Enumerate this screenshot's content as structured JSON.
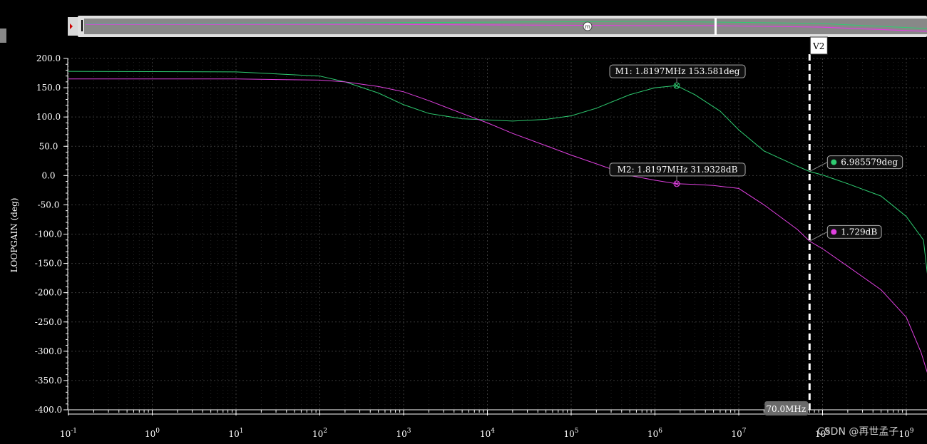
{
  "chart_data": {
    "type": "line",
    "ylabel": "LOOPGAIN (deg)",
    "xscale": "log",
    "x_decade_min": -1,
    "x_decade_max": 8,
    "ylim": [
      -400,
      200
    ],
    "yticks": [
      "200.0",
      "150.0",
      "100.0",
      "50.0",
      "0.0",
      "-50.0",
      "-100.0",
      "-150.0",
      "-200.0",
      "-250.0",
      "-300.0",
      "-350.0",
      "-400.0"
    ],
    "xticks": [
      {
        "base": "10",
        "exp": "-1"
      },
      {
        "base": "10",
        "exp": "0"
      },
      {
        "base": "10",
        "exp": "1"
      },
      {
        "base": "10",
        "exp": "2"
      },
      {
        "base": "10",
        "exp": "3"
      },
      {
        "base": "10",
        "exp": "4"
      },
      {
        "base": "10",
        "exp": "5"
      },
      {
        "base": "10",
        "exp": "6"
      },
      {
        "base": "10",
        "exp": "7"
      },
      {
        "base": "10",
        "exp": "8"
      },
      {
        "base": "10",
        "exp": "9"
      }
    ],
    "grid": true,
    "series": [
      {
        "color": "#2ecc71",
        "x": [
          0.1,
          10,
          100,
          200,
          500,
          1000,
          2000,
          5000,
          10000,
          20000,
          50000,
          100000,
          200000,
          500000,
          1000000,
          1800000,
          3000000,
          6000000,
          10000000,
          20000000,
          50000000,
          70000000,
          100000000,
          200000000,
          500000000,
          1000000000,
          1600000000,
          2000000000
        ],
        "y": [
          178,
          177,
          170,
          160,
          141,
          121,
          106,
          97,
          95,
          93,
          96,
          102,
          115,
          138,
          150,
          153.6,
          138,
          110,
          78,
          42,
          16,
          7,
          1,
          -14,
          -35,
          -70,
          -110,
          -230
        ]
      },
      {
        "color": "#e040e0",
        "x": [
          0.1,
          10,
          100,
          200,
          500,
          1000,
          2000,
          5000,
          10000,
          20000,
          50000,
          100000,
          200000,
          500000,
          1000000,
          1800000,
          3000000,
          5000000,
          10000000,
          20000000,
          50000000,
          70000000,
          100000000,
          200000000,
          500000000,
          1000000000,
          1500000000,
          2000000000
        ],
        "y": [
          165,
          165,
          163,
          160,
          152,
          143,
          128,
          106,
          90,
          72,
          51,
          35,
          20,
          0,
          -8,
          -14,
          -15,
          -17,
          -22,
          -50,
          -92,
          -112,
          -125,
          -155,
          -195,
          -242,
          -302,
          -360
        ]
      }
    ],
    "cursor": {
      "label": "V2",
      "x": 70000000,
      "readout": "70.0MHz"
    },
    "markers": [
      {
        "label": "M1: 1.8197MHz 153.581deg",
        "x": 1819700,
        "y": 153.581,
        "color": "#2ecc71"
      },
      {
        "label": "M2: 1.8197MHz 31.9328dB",
        "x": 1819700,
        "y": -14,
        "color": "#e040e0"
      }
    ],
    "cursor_values": [
      {
        "text": "6.985579deg",
        "y": 7,
        "color": "#2ecc71"
      },
      {
        "text": "1.729dB",
        "y": -112,
        "color": "#e040e0"
      }
    ]
  },
  "watermark": "CSDN @再世孟子",
  "scroll_icon": "m-circle-icon"
}
